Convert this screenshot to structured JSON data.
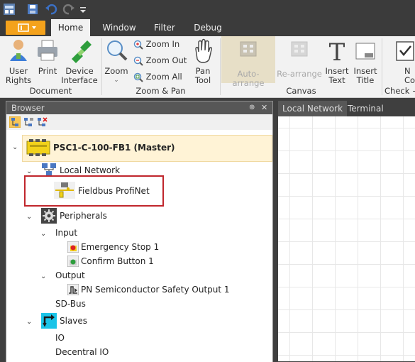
{
  "ribbon_tabs": {
    "file_menu": "",
    "home": "Home",
    "window": "Window",
    "filter": "Filter",
    "debug": "Debug"
  },
  "ribbon": {
    "user_rights": "User\nRights",
    "print": "Print",
    "device_interface": "Device\nInterface",
    "document_group": "Document",
    "zoom": "Zoom",
    "zoom_in": "Zoom In",
    "zoom_out": "Zoom Out",
    "zoom_all": "Zoom All",
    "pan_tool": "Pan\nTool",
    "zoom_pan_group": "Zoom & Pan",
    "auto_arrange": "Auto-arrange",
    "re_arrange": "Re-arrange",
    "insert_text": "Insert\nText",
    "insert_title": "Insert\nTitle",
    "canvas_group": "Canvas",
    "check_group": "Check +",
    "partial_button": "N\nCom"
  },
  "browser": {
    "title": "Browser",
    "pin": "⊕",
    "close": "✕",
    "tree": {
      "root": "PSC1-C-100-FB1 (Master)",
      "local_network": "Local Network",
      "fieldbus": "Fieldbus ProfiNet",
      "peripherals": "Peripherals",
      "input": "Input",
      "emergency_stop": "Emergency Stop 1",
      "confirm_button": "Confirm Button 1",
      "output": "Output",
      "pn_output": "PN Semiconductor Safety Output 1",
      "sd_bus": "SD-Bus",
      "slaves": "Slaves",
      "io": "IO",
      "decentral_io": "Decentral IO"
    }
  },
  "canvas_tabs": {
    "local_network": "Local Network",
    "terminal_scheme": "Terminal Scheme"
  },
  "colors": {
    "accent_orange": "#f4a21c",
    "highlight_red": "#c0262c",
    "root_bg": "#fff3d6"
  }
}
